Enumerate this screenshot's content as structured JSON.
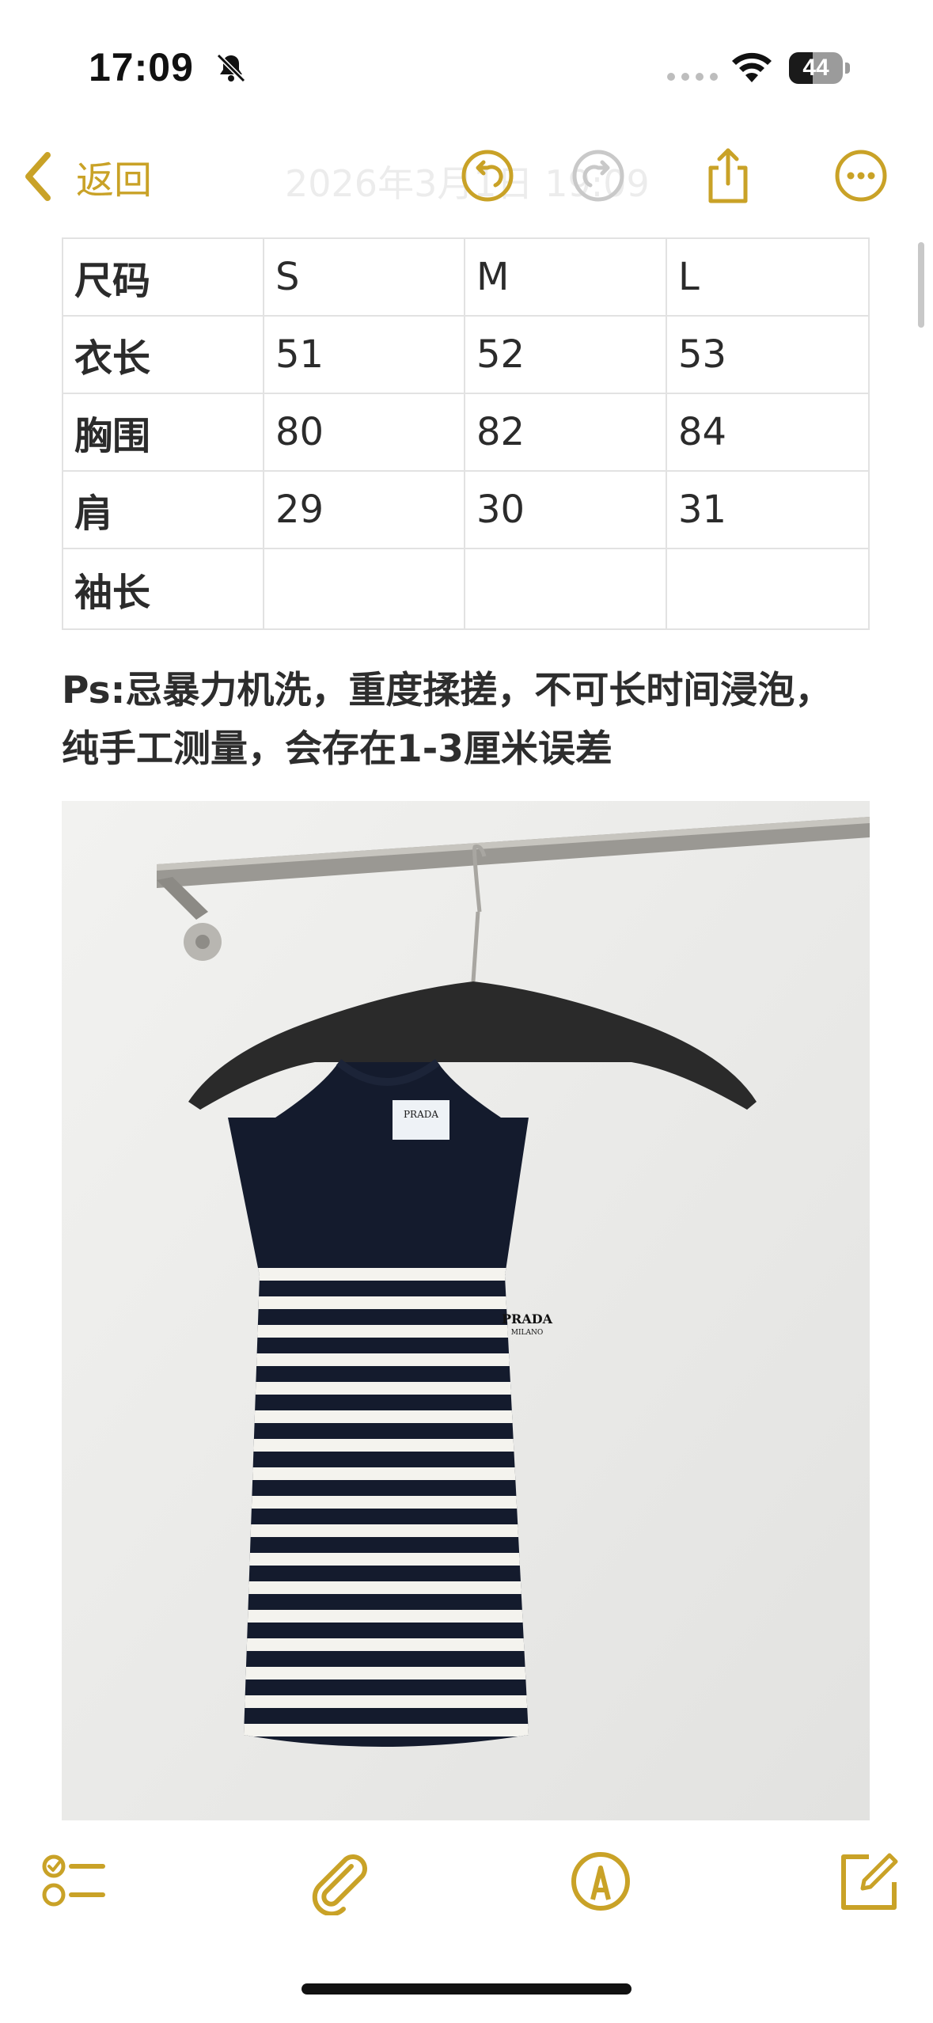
{
  "status_bar": {
    "time": "17:09",
    "battery_text": "44",
    "battery_level": 0.44,
    "icons": [
      "bell-slash-icon",
      "cellular-signal-icon",
      "wifi-icon",
      "battery-icon"
    ]
  },
  "nav": {
    "back_label": "返回",
    "title": "2026年3月1日 19:09",
    "icons": [
      "undo-icon",
      "redo-icon",
      "share-icon",
      "more-icon"
    ]
  },
  "size_table": {
    "columns": [
      "尺码",
      "S",
      "M",
      "L"
    ],
    "rows": [
      {
        "label": "衣长",
        "values": [
          "51",
          "52",
          "53"
        ]
      },
      {
        "label": "胸围",
        "values": [
          "80",
          "82",
          "84"
        ]
      },
      {
        "label": "肩",
        "values": [
          "29",
          "30",
          "31"
        ]
      },
      {
        "label": "袖长",
        "values": [
          "",
          "",
          ""
        ]
      }
    ]
  },
  "note": {
    "line1": "Ps:忌暴力机洗，重度揉搓，不可长时间浸泡，",
    "line2": "纯手工测量，会存在1-3厘米误差"
  },
  "photo": {
    "description_icon": "photo-sleeveless-striped-top",
    "label_text": "PRADA",
    "label_subtext": "MILANO"
  },
  "toolbar": {
    "icons": [
      "checklist-icon",
      "attachment-icon",
      "markup-pen-icon",
      "compose-icon"
    ]
  },
  "colors": {
    "accent": "#c9a227",
    "navy": "#141b2d",
    "stripe_white": "#f4f3ee"
  }
}
